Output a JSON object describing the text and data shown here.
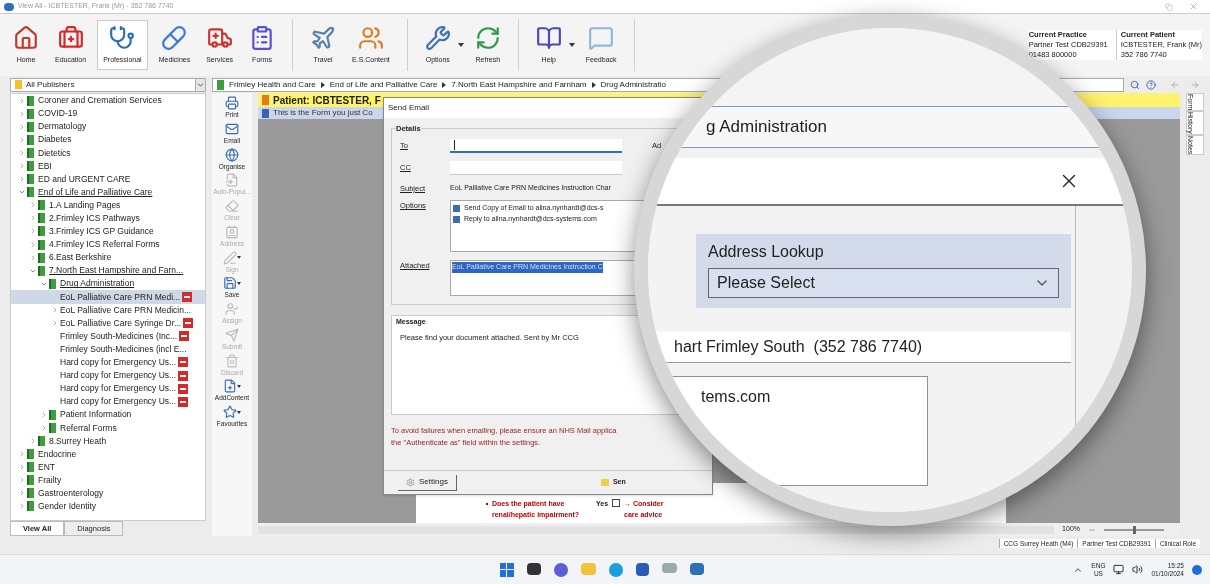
{
  "window": {
    "title": "View All - ICBTESTER, Frank (Mr) - 352 786 7740"
  },
  "toolbar": [
    [
      {
        "label": "Home",
        "selected": false,
        "dropdown": false
      },
      {
        "label": "Education",
        "selected": false,
        "dropdown": false
      },
      {
        "label": "Professional",
        "selected": true,
        "dropdown": false
      },
      {
        "label": "Medicines",
        "selected": false,
        "dropdown": false
      },
      {
        "label": "Services",
        "selected": false,
        "dropdown": false
      },
      {
        "label": "Forms",
        "selected": false,
        "dropdown": false
      }
    ],
    [
      {
        "label": "Travel",
        "selected": false,
        "dropdown": false
      },
      {
        "label": "E.S.Content",
        "selected": false,
        "dropdown": false
      }
    ],
    [
      {
        "label": "Options",
        "selected": false,
        "dropdown": true
      },
      {
        "label": "Refresh",
        "selected": false,
        "dropdown": false
      }
    ],
    [
      {
        "label": "Help",
        "selected": false,
        "dropdown": true
      },
      {
        "label": "Feedback",
        "selected": false,
        "dropdown": false
      }
    ]
  ],
  "context": {
    "practice_heading": "Current Practice",
    "practice_name": "Partner Test CDB29391",
    "practice_phone": "01483 800000",
    "patient_heading": "Current Patient",
    "patient_name": "ICBTESTER, Frank (Mr)",
    "patient_phone": "352 786 7740"
  },
  "publisher_select": {
    "value": "All Publishers"
  },
  "breadcrumb": [
    "Frimley Health and Care",
    "End of Life and Palliative Care",
    "7.North East Hampshire and Farnham",
    "Drug Administratio"
  ],
  "tree": [
    {
      "label": "Coroner and Cremation Services",
      "kind": "folder",
      "expanded": false,
      "selected": false
    },
    {
      "label": "COVID-19",
      "kind": "folder",
      "expanded": false,
      "selected": false
    },
    {
      "label": "Dermatology",
      "kind": "folder",
      "expanded": false,
      "selected": false
    },
    {
      "label": "Diabetes",
      "kind": "folder",
      "expanded": false,
      "selected": false
    },
    {
      "label": "Dietetics",
      "kind": "folder",
      "expanded": false,
      "selected": false
    },
    {
      "label": "EBI",
      "kind": "folder",
      "expanded": false,
      "selected": false
    },
    {
      "label": "ED and URGENT CARE",
      "kind": "folder",
      "expanded": false,
      "selected": false
    },
    {
      "label": "End of Life and Palliative Care",
      "kind": "folder",
      "expanded": true,
      "selected": false,
      "children": [
        {
          "label": "1.A Landing Pages",
          "kind": "folder",
          "expanded": false,
          "selected": false
        },
        {
          "label": "2.Frimley ICS Pathways",
          "kind": "folder",
          "expanded": false,
          "selected": false
        },
        {
          "label": "3.Frimley ICS GP Guidance",
          "kind": "folder",
          "expanded": false,
          "selected": false
        },
        {
          "label": "4.Frimley ICS Referral Forms",
          "kind": "folder",
          "expanded": false,
          "selected": false
        },
        {
          "label": "6.East Berkshire",
          "kind": "folder",
          "expanded": false,
          "selected": false
        },
        {
          "label": "7.North East Hampshire and Farn...",
          "kind": "folder",
          "expanded": true,
          "selected": false,
          "children": [
            {
              "label": "Drug Administration",
              "kind": "folder",
              "expanded": true,
              "selected": false,
              "children": [
                {
                  "label": "EoL Palliative Care PRN Medi...",
                  "kind": "doc",
                  "selected": true,
                  "badge": true
                },
                {
                  "label": "EoL Palliative Care PRN Medicin...",
                  "kind": "doc",
                  "expanded": false,
                  "selected": false,
                  "badge": false
                },
                {
                  "label": "EoL Palliative Care Syringe Dr...",
                  "kind": "doc",
                  "expanded": false,
                  "selected": false,
                  "badge": true
                },
                {
                  "label": "Frimley South-Medicines (Inc...",
                  "kind": "doc",
                  "selected": false,
                  "badge": true
                },
                {
                  "label": "Frimley South-Medicines (incl E...",
                  "kind": "doc",
                  "selected": false,
                  "badge": false
                },
                {
                  "label": "Hard copy for Emergency Us...",
                  "kind": "doc",
                  "selected": false,
                  "badge": true
                },
                {
                  "label": "Hard copy for Emergency Us...",
                  "kind": "doc",
                  "selected": false,
                  "badge": true
                },
                {
                  "label": "Hard copy for Emergency Us...",
                  "kind": "doc",
                  "selected": false,
                  "badge": true
                },
                {
                  "label": "Hard copy for Emergency Us...",
                  "kind": "doc",
                  "selected": false,
                  "badge": true
                }
              ]
            },
            {
              "label": "Patient Information",
              "kind": "folder",
              "expanded": false,
              "selected": false
            },
            {
              "label": "Referral Forms",
              "kind": "folder",
              "expanded": false,
              "selected": false
            }
          ]
        },
        {
          "label": "8.Surrey Heath",
          "kind": "folder",
          "expanded": false,
          "selected": false
        }
      ]
    },
    {
      "label": "Endocrine",
      "kind": "folder",
      "expanded": false,
      "selected": false
    },
    {
      "label": "ENT",
      "kind": "folder",
      "expanded": false,
      "selected": false
    },
    {
      "label": "Frailty",
      "kind": "folder",
      "expanded": false,
      "selected": false
    },
    {
      "label": "Gastroenterology",
      "kind": "folder",
      "expanded": false,
      "selected": false
    },
    {
      "label": "Gender Identity",
      "kind": "folder",
      "expanded": false,
      "selected": false
    }
  ],
  "tree_tabs": [
    {
      "label": "View All",
      "selected": true
    },
    {
      "label": "Diagnosis",
      "selected": false
    }
  ],
  "actions": [
    {
      "label": "Print",
      "disabled": false,
      "dropdown": false
    },
    {
      "label": "Email",
      "disabled": false,
      "dropdown": false
    },
    {
      "label": "Organise",
      "disabled": false,
      "dropdown": false
    },
    {
      "label": "Auto-Popul...",
      "disabled": true,
      "dropdown": false
    },
    {
      "label": "Clear",
      "disabled": true,
      "dropdown": false
    },
    {
      "label": "Address",
      "disabled": true,
      "dropdown": false
    },
    {
      "label": "Sign",
      "disabled": true,
      "dropdown": true
    },
    {
      "label": "Save",
      "disabled": false,
      "dropdown": true
    },
    {
      "label": "Assign",
      "disabled": true,
      "dropdown": false
    },
    {
      "label": "Submit",
      "disabled": true,
      "dropdown": false
    },
    {
      "label": "Discard",
      "disabled": true,
      "dropdown": false
    },
    {
      "label": "AddContent",
      "disabled": false,
      "dropdown": true
    },
    {
      "label": "Favourites",
      "disabled": false,
      "dropdown": true
    }
  ],
  "form": {
    "patient_banner": "Patient: ICBTESTER, F",
    "info_bar": "This is the Form you just Co",
    "question": "Does the patient have renal/hepatic impairment?",
    "answer": "Yes",
    "answer_checked": false,
    "advice": [
      "→ Consider",
      "care advice"
    ],
    "side_tabs": [
      "Form",
      "History",
      "Notes"
    ],
    "zoom": {
      "reading": "100%",
      "level": 0.5
    }
  },
  "dialog": {
    "title": "Send Email",
    "details_heading": "Details",
    "to_label": "To",
    "cc_label": "CC",
    "subject_label": "Subject",
    "subject": "EoL Palliative Care PRN Medicines Instruction Char",
    "options_label": "Options",
    "options": [
      {
        "label": "Send Copy of Email to alina.nynhardt@dcs-s",
        "checked": true
      },
      {
        "label": "Reply to alina.nynhardt@dcs-systems.com",
        "checked": true
      }
    ],
    "attached_label": "Attached",
    "attachments": [
      {
        "label": "EoL Palliative Care PRN Medicines Instruction C",
        "selected": true
      }
    ],
    "address_label": "Ad",
    "message_heading": "Message",
    "message": "Please find your document attached.  Sent by Mr CCG",
    "warning": [
      "To avoid failures when emailing, please ensure an  NHS Mail applica",
      "the \"Authenticate as\" field within the settings."
    ],
    "settings_button": "Settings",
    "send_button": "Sen"
  },
  "magnifier": {
    "heading": "g Administration",
    "lookup_label": "Address Lookup",
    "lookup_value": "Please Select",
    "recipient": "hart Frimley South  (352 786 7740)",
    "reply_text": "tems.com"
  },
  "status_bar": [
    "CCG Surrey Heath (M4)",
    "Partner Test CDB29391",
    "Clinical Role"
  ],
  "taskbar": {
    "language": "ENG",
    "region": "US",
    "time": "15:25",
    "date": "01/10/2024"
  }
}
